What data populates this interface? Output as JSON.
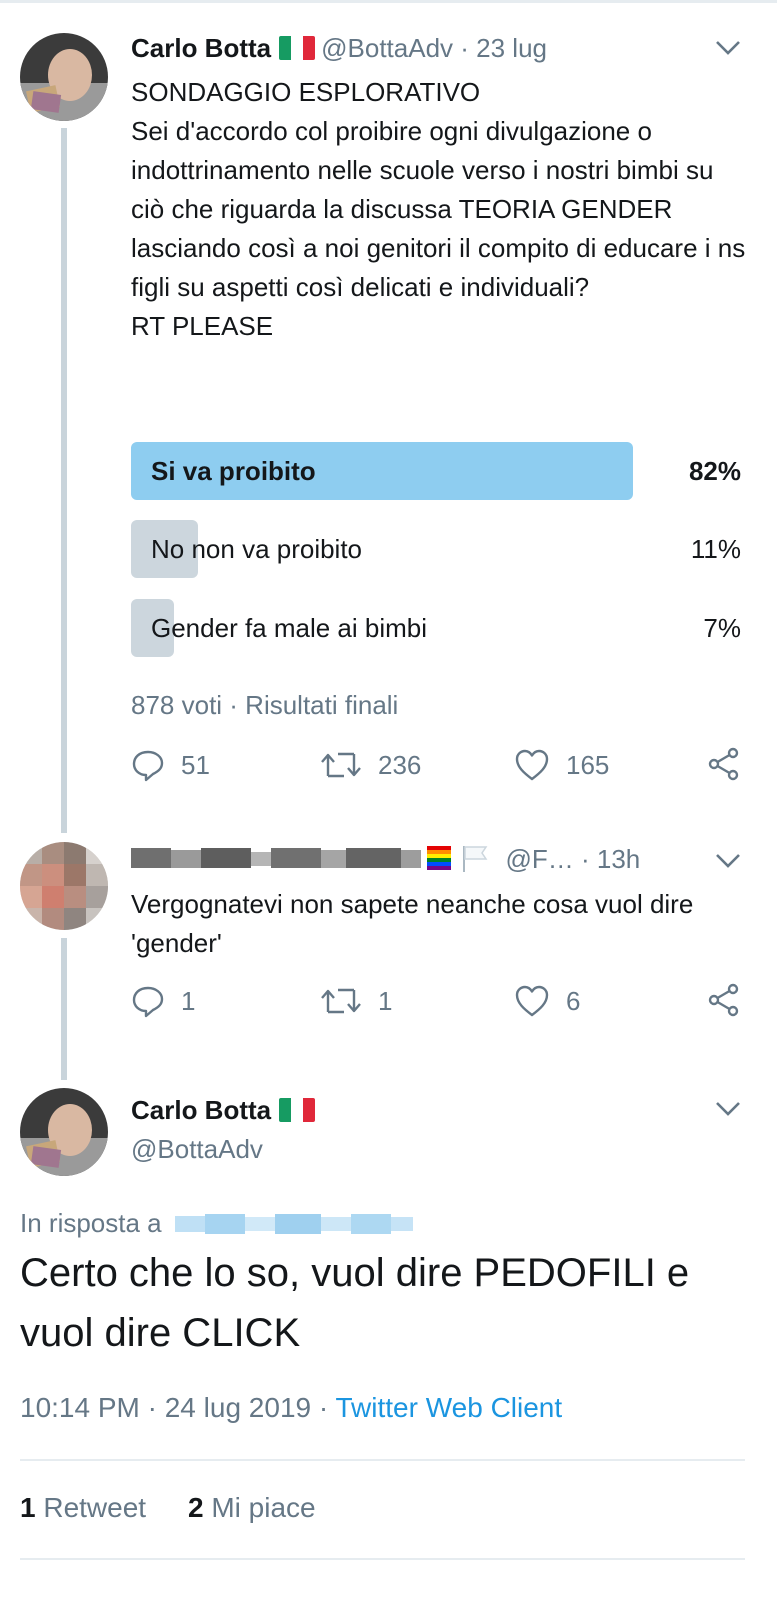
{
  "tweet1": {
    "name": "Carlo Botta",
    "handle": "@BottaAdv",
    "time": "· 23 lug",
    "text": "SONDAGGIO ESPLORATIVO\nSei d'accordo col proibire ogni divulgazione o indottrinamento nelle scuole verso i nostri bimbi su ciò che riguarda la discussa TEORIA GENDER\nlasciando così a noi genitori il compito di educare i ns figli su aspetti così delicati e individuali?\nRT PLEASE",
    "poll": [
      {
        "label": "Si va proibito",
        "percent_text": "82%",
        "percent": 82,
        "winner": true
      },
      {
        "label": "No non va proibito",
        "percent_text": "11%",
        "percent": 11,
        "winner": false
      },
      {
        "label": "Gender fa male ai bimbi",
        "percent_text": "7%",
        "percent": 7,
        "winner": false
      }
    ],
    "poll_meta": "878 voti · Risultati finali",
    "replies": "51",
    "retweets": "236",
    "likes": "165"
  },
  "tweet2": {
    "handle": "@F…",
    "time": "· 13h",
    "text": "Vergognatevi non sapete neanche cosa vuol dire 'gender'",
    "replies": "1",
    "retweets": "1",
    "likes": "6"
  },
  "tweet3": {
    "name": "Carlo Botta",
    "handle": "@BottaAdv",
    "reply_to_label": "In risposta a",
    "text": "Certo che lo so, vuol dire PEDOFILI e vuol dire CLICK",
    "timestamp": "10:14 PM · 24 lug 2019 ·",
    "client": "Twitter Web Client",
    "retweet_count": "1",
    "retweet_label": "Retweet",
    "like_count": "2",
    "like_label": "Mi piace"
  },
  "colors": {
    "poll_winner": "#8ecdf0",
    "poll_other": "#ccd6dd",
    "link": "#1b95e0",
    "muted": "#657786",
    "thread_line": "#c9d4db"
  }
}
